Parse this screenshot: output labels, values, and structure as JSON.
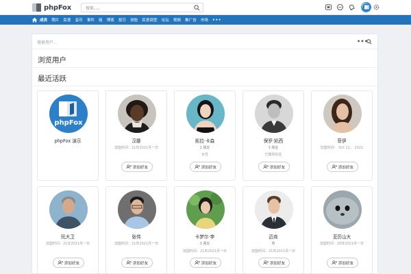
{
  "header": {
    "logo_text": "phpFox",
    "search_placeholder": "搜索。。。",
    "icons": [
      "apps-icon",
      "chat-icon",
      "bell-icon",
      "user-avatar",
      "gear-icon"
    ]
  },
  "nav": {
    "items": [
      "成员",
      "照片",
      "民意",
      "音乐",
      "事件",
      "组",
      "博客",
      "投引",
      "测验",
      "民意调查",
      "论坛",
      "视频",
      "推广告",
      "市场"
    ],
    "more": "•••"
  },
  "filter": {
    "placeholder": "搜索用户..."
  },
  "sections": {
    "browse": "浏览用户",
    "recent": "最近活跃"
  },
  "add_friend_label": "添加好友",
  "members": [
    {
      "name": "phpFox 演示",
      "join": "",
      "friends": "",
      "extra": "",
      "has_button": false
    },
    {
      "name": "汉娜",
      "join": "加盟时间：21年2021月一日",
      "friends": "",
      "extra": "",
      "has_button": true
    },
    {
      "name": "凯拉·卡森",
      "friends": "2 朋友",
      "extra": "女性",
      "join": "",
      "has_button": true
    },
    {
      "name": "保罗·凯西",
      "friends": "3 朋友",
      "extra": "已婚有好友",
      "join": "",
      "has_button": true
    },
    {
      "name": "菲伊",
      "join": "加盟时间：  Oct 12，  2022",
      "friends": "",
      "extra": "",
      "has_button": true
    },
    {
      "name": "阮大卫",
      "join": "加盟时间：21年2021月一日",
      "friends": "",
      "extra": "",
      "has_button": true
    },
    {
      "name": "张伟",
      "join": "加盟时间：21年2021月一日",
      "friends": "",
      "extra": "",
      "has_button": true
    },
    {
      "name": "卡梦尔·李",
      "friends": "3 朋友",
      "join": "加盟时间：21年2021月一日",
      "extra": "",
      "has_button": true
    },
    {
      "name": "迈商",
      "friends": "男",
      "join": "加盟时间：21年2021月一日",
      "extra": "",
      "has_button": true
    },
    {
      "name": "亚历山大",
      "join": "加盟时间：26年2021月一日",
      "friends": "",
      "extra": "",
      "has_button": true
    }
  ],
  "colors": {
    "nav_blue": "#2474bc",
    "logo_blue": "#2c80c8",
    "page_bg": "#eef0f3"
  }
}
